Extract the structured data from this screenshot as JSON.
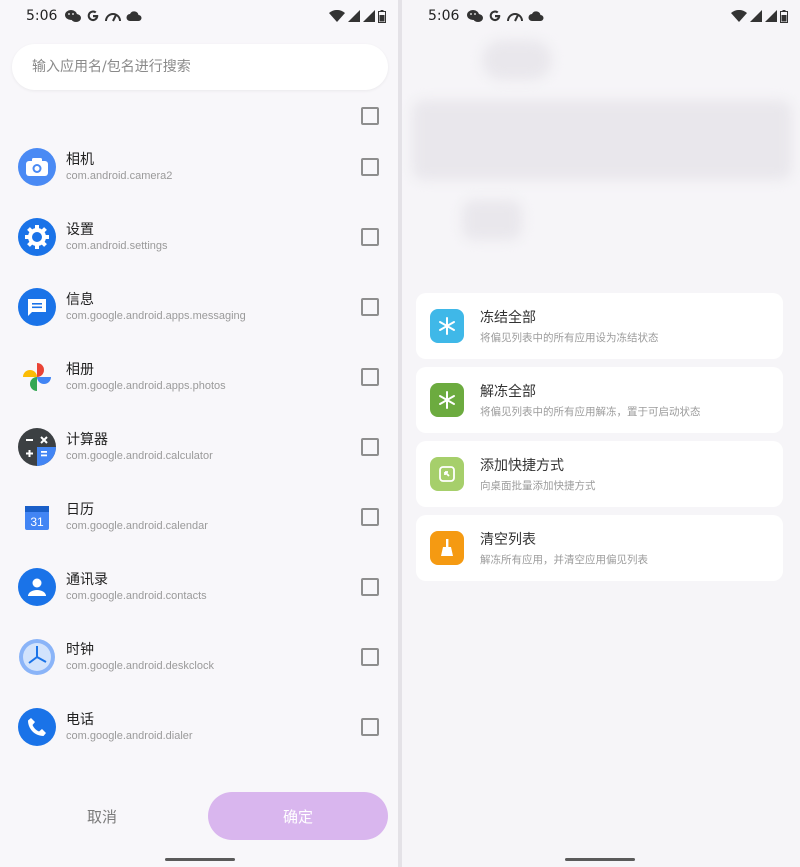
{
  "left_screen": {
    "status": {
      "time": "5:06"
    },
    "search": {
      "placeholder": "输入应用名/包名进行搜索"
    },
    "apps": [
      {
        "name": "相机",
        "package": "com.android.camera2",
        "icon": "camera-icon",
        "color": "#4a8af4"
      },
      {
        "name": "设置",
        "package": "com.android.settings",
        "icon": "gear-icon",
        "color": "#1a73e8"
      },
      {
        "name": "信息",
        "package": "com.google.android.apps.messaging",
        "icon": "message-icon",
        "color": "#1a73e8"
      },
      {
        "name": "相册",
        "package": "com.google.android.apps.photos",
        "icon": "pinwheel-icon",
        "color": "#ffffff"
      },
      {
        "name": "计算器",
        "package": "com.google.android.calculator",
        "icon": "calculator-icon",
        "color": "#3c4043"
      },
      {
        "name": "日历",
        "package": "com.google.android.calendar",
        "icon": "calendar-icon",
        "color": "#ffffff"
      },
      {
        "name": "通讯录",
        "package": "com.google.android.contacts",
        "icon": "person-icon",
        "color": "#1a73e8"
      },
      {
        "name": "时钟",
        "package": "com.google.android.deskclock",
        "icon": "clock-icon",
        "color": "#e8f0fe"
      },
      {
        "name": "电话",
        "package": "com.google.android.dialer",
        "icon": "phone-icon",
        "color": "#1a73e8"
      }
    ],
    "calendar_day": "31",
    "footer": {
      "cancel_label": "取消",
      "ok_label": "确定"
    }
  },
  "right_screen": {
    "status": {
      "time": "5:06"
    },
    "actions": [
      {
        "title": "冻结全部",
        "desc": "将偏见列表中的所有应用设为冻结状态",
        "icon": "snowflake-icon",
        "color": "#3fb8e8"
      },
      {
        "title": "解冻全部",
        "desc": "将偏见列表中的所有应用解冻，置于可启动状态",
        "icon": "snowflake-icon",
        "color": "#6cab3f"
      },
      {
        "title": "添加快捷方式",
        "desc": "向桌面批量添加快捷方式",
        "icon": "shortcut-icon",
        "color": "#a6cf6b"
      },
      {
        "title": "清空列表",
        "desc": "解冻所有应用，并清空应用偏见列表",
        "icon": "broom-icon",
        "color": "#f59a12"
      }
    ]
  }
}
